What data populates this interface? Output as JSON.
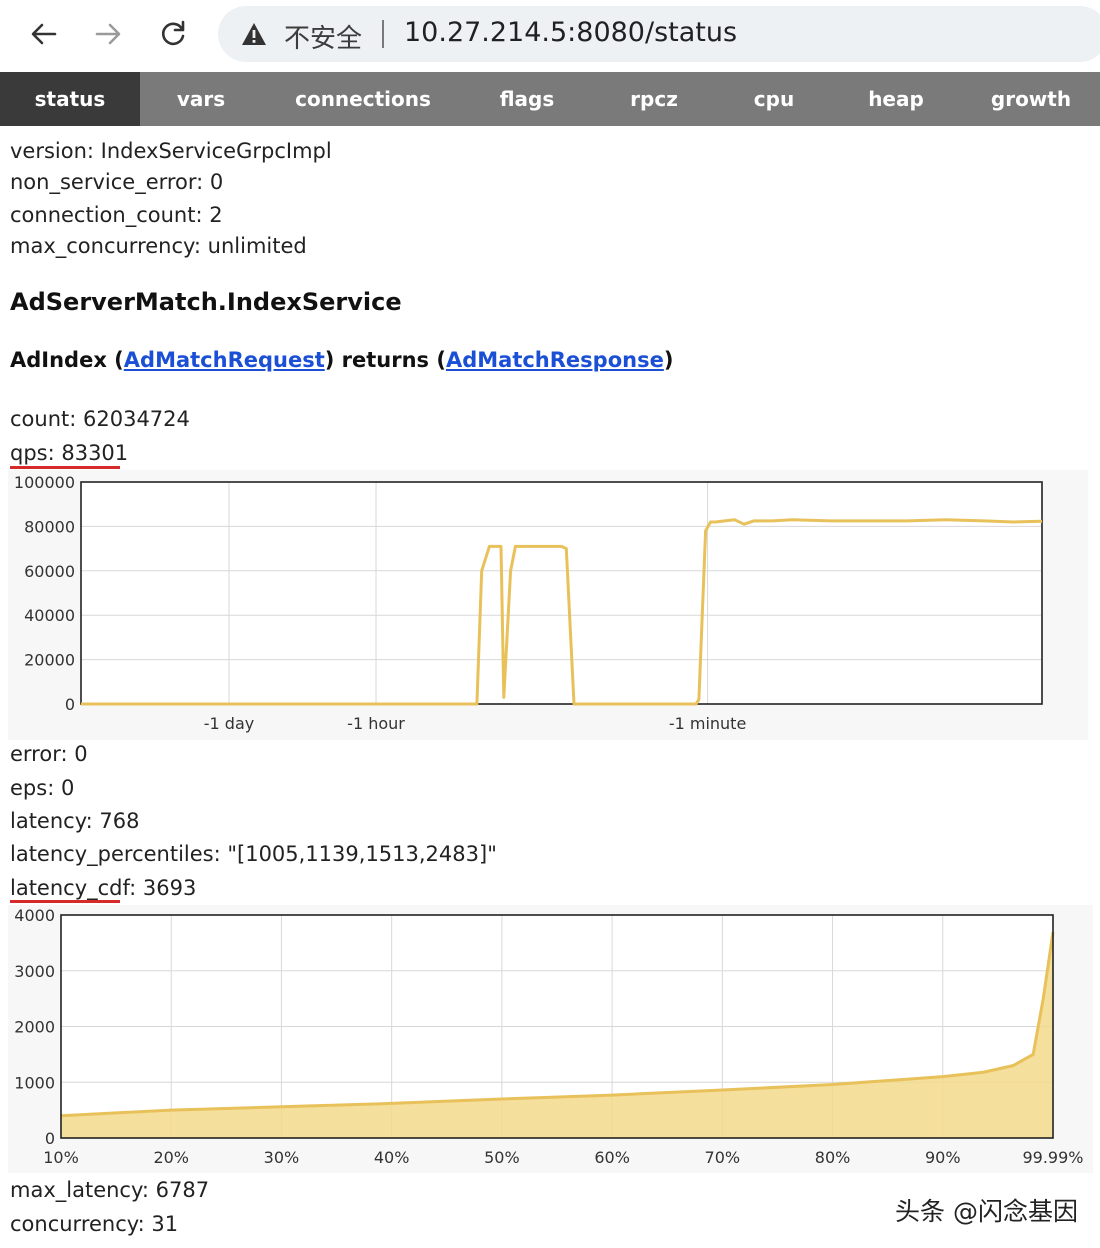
{
  "browser": {
    "security_label": "不安全",
    "url": "10.27.214.5:8080/status"
  },
  "tabs": [
    {
      "label": "status",
      "active": true
    },
    {
      "label": "vars",
      "active": false
    },
    {
      "label": "connections",
      "active": false
    },
    {
      "label": "flags",
      "active": false
    },
    {
      "label": "rpcz",
      "active": false
    },
    {
      "label": "cpu",
      "active": false
    },
    {
      "label": "heap",
      "active": false
    },
    {
      "label": "growth",
      "active": false
    }
  ],
  "server": {
    "version": "version: IndexServiceGrpcImpl",
    "non_service_error": "non_service_error: 0",
    "connection_count": "connection_count: 2",
    "max_concurrency": "max_concurrency: unlimited"
  },
  "service": {
    "title": "AdServerMatch.IndexService",
    "method_prefix": "AdIndex (",
    "request_link": "AdMatchRequest",
    "method_middle": ") returns (",
    "response_link": "AdMatchResponse",
    "method_suffix": ")"
  },
  "stats": {
    "count": "count: 62034724",
    "qps": "qps: 83301",
    "error": "error: 0",
    "eps": "eps: 0",
    "latency": "latency: 768",
    "latency_percentiles": "latency_percentiles: \"[1005,1139,1513,2483]\"",
    "latency_cdf": "latency_cdf: 3693",
    "max_latency": "max_latency: 6787",
    "concurrency": "concurrency: 31"
  },
  "colors": {
    "tab_bg": "#7a7a7a",
    "tab_active_bg": "#3a3a3a",
    "series_line": "#e8c15a",
    "series_fill": "#f3d98b",
    "grid": "#d8d8d8",
    "link": "#1a4fd6",
    "highlight_underline": "#d62a2a"
  },
  "chart_data": [
    {
      "type": "line",
      "title": "",
      "ylim": [
        0,
        100000
      ],
      "y_ticks": [
        "100000",
        "80000",
        "60000",
        "40000",
        "20000",
        "0"
      ],
      "x_labels": [
        "-1 day",
        "-1 hour",
        "-1 minute"
      ],
      "x_label_fractions": [
        0.154,
        0.307,
        0.652
      ],
      "series": [
        {
          "x_fraction": [
            0.0,
            0.41,
            0.412,
            0.417,
            0.425,
            0.432,
            0.437,
            0.44,
            0.447,
            0.452,
            0.458,
            0.5,
            0.505,
            0.513,
            0.52,
            0.585,
            0.64,
            0.643,
            0.65,
            0.655,
            0.66,
            0.68,
            0.69,
            0.7,
            0.72,
            0.74,
            0.78,
            0.82,
            0.86,
            0.9,
            0.94,
            0.97,
            1.0
          ],
          "values": [
            0,
            0,
            0,
            60000,
            71000,
            71000,
            71000,
            3000,
            60000,
            71000,
            71000,
            71000,
            70000,
            0,
            0,
            0,
            0,
            2000,
            78000,
            82000,
            82000,
            83000,
            81000,
            82500,
            82500,
            83000,
            82500,
            82500,
            82500,
            83000,
            82500,
            82000,
            82300
          ]
        }
      ]
    },
    {
      "type": "area",
      "title": "",
      "ylim": [
        0,
        4000
      ],
      "y_ticks": [
        "4000",
        "3000",
        "2000",
        "1000",
        "0"
      ],
      "categories": [
        "10%",
        "20%",
        "30%",
        "40%",
        "50%",
        "60%",
        "70%",
        "80%",
        "90%",
        "99.99%"
      ],
      "series": [
        {
          "x_fraction": [
            0.0,
            0.111,
            0.222,
            0.333,
            0.444,
            0.556,
            0.667,
            0.778,
            0.889,
            0.93,
            0.96,
            0.98,
            0.99,
            1.0
          ],
          "values": [
            400,
            500,
            560,
            620,
            700,
            770,
            860,
            960,
            1100,
            1180,
            1300,
            1500,
            2483,
            3693
          ]
        }
      ]
    }
  ],
  "watermark": "头条 @闪念基因"
}
